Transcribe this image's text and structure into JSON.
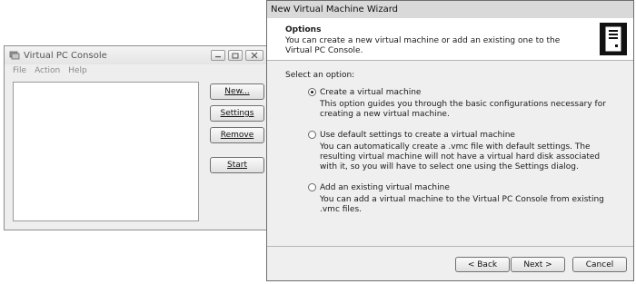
{
  "console": {
    "title": "Virtual PC Console",
    "menu": [
      "File",
      "Action",
      "Help"
    ],
    "buttons": {
      "new": "New...",
      "settings": "Settings",
      "remove": "Remove",
      "start": "Start"
    }
  },
  "wizard": {
    "title": "New Virtual Machine Wizard",
    "header": {
      "title": "Options",
      "description": "You can create a new virtual machine or add an existing one to the Virtual PC Console."
    },
    "prompt": "Select an option:",
    "options": [
      {
        "label": "Create a virtual machine",
        "description": "This option guides you through the basic configurations necessary for creating a new virtual machine.",
        "selected": true
      },
      {
        "label": "Use default settings to create a virtual machine",
        "description": "You can automatically create a .vmc file with default settings. The resulting virtual machine will not have a virtual hard disk associated with it, so you will have to select one using the Settings dialog.",
        "selected": false
      },
      {
        "label": "Add an existing virtual machine",
        "description": "You can add a virtual machine to the Virtual PC Console from existing .vmc files.",
        "selected": false
      }
    ],
    "buttons": {
      "back": "< Back",
      "next": "Next >",
      "cancel": "Cancel"
    }
  },
  "icons": {
    "console_app": "virtual-pc-icon",
    "wizard_header": "computer-tower-icon"
  }
}
